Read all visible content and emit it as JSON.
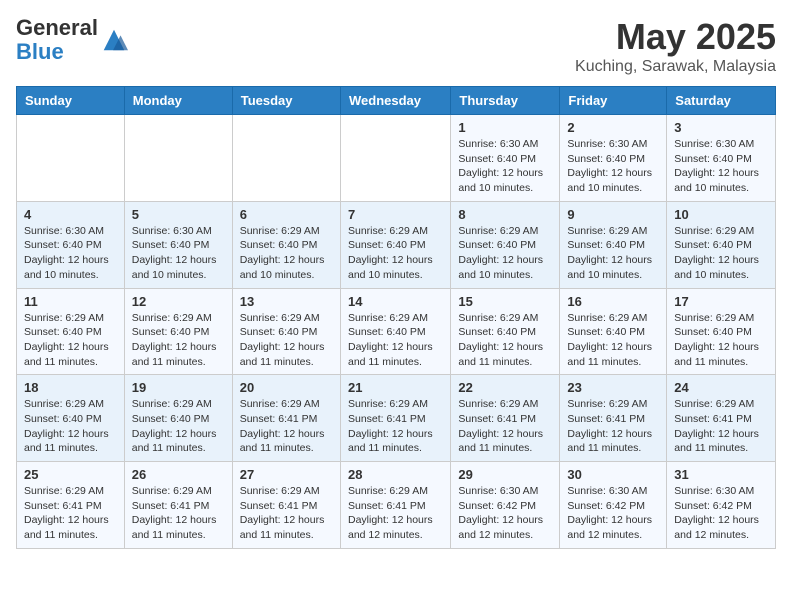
{
  "header": {
    "logo_general": "General",
    "logo_blue": "Blue",
    "month": "May 2025",
    "location": "Kuching, Sarawak, Malaysia"
  },
  "days_of_week": [
    "Sunday",
    "Monday",
    "Tuesday",
    "Wednesday",
    "Thursday",
    "Friday",
    "Saturday"
  ],
  "weeks": [
    [
      {
        "day": "",
        "info": ""
      },
      {
        "day": "",
        "info": ""
      },
      {
        "day": "",
        "info": ""
      },
      {
        "day": "",
        "info": ""
      },
      {
        "day": "1",
        "info": "Sunrise: 6:30 AM\nSunset: 6:40 PM\nDaylight: 12 hours\nand 10 minutes."
      },
      {
        "day": "2",
        "info": "Sunrise: 6:30 AM\nSunset: 6:40 PM\nDaylight: 12 hours\nand 10 minutes."
      },
      {
        "day": "3",
        "info": "Sunrise: 6:30 AM\nSunset: 6:40 PM\nDaylight: 12 hours\nand 10 minutes."
      }
    ],
    [
      {
        "day": "4",
        "info": "Sunrise: 6:30 AM\nSunset: 6:40 PM\nDaylight: 12 hours\nand 10 minutes."
      },
      {
        "day": "5",
        "info": "Sunrise: 6:30 AM\nSunset: 6:40 PM\nDaylight: 12 hours\nand 10 minutes."
      },
      {
        "day": "6",
        "info": "Sunrise: 6:29 AM\nSunset: 6:40 PM\nDaylight: 12 hours\nand 10 minutes."
      },
      {
        "day": "7",
        "info": "Sunrise: 6:29 AM\nSunset: 6:40 PM\nDaylight: 12 hours\nand 10 minutes."
      },
      {
        "day": "8",
        "info": "Sunrise: 6:29 AM\nSunset: 6:40 PM\nDaylight: 12 hours\nand 10 minutes."
      },
      {
        "day": "9",
        "info": "Sunrise: 6:29 AM\nSunset: 6:40 PM\nDaylight: 12 hours\nand 10 minutes."
      },
      {
        "day": "10",
        "info": "Sunrise: 6:29 AM\nSunset: 6:40 PM\nDaylight: 12 hours\nand 10 minutes."
      }
    ],
    [
      {
        "day": "11",
        "info": "Sunrise: 6:29 AM\nSunset: 6:40 PM\nDaylight: 12 hours\nand 11 minutes."
      },
      {
        "day": "12",
        "info": "Sunrise: 6:29 AM\nSunset: 6:40 PM\nDaylight: 12 hours\nand 11 minutes."
      },
      {
        "day": "13",
        "info": "Sunrise: 6:29 AM\nSunset: 6:40 PM\nDaylight: 12 hours\nand 11 minutes."
      },
      {
        "day": "14",
        "info": "Sunrise: 6:29 AM\nSunset: 6:40 PM\nDaylight: 12 hours\nand 11 minutes."
      },
      {
        "day": "15",
        "info": "Sunrise: 6:29 AM\nSunset: 6:40 PM\nDaylight: 12 hours\nand 11 minutes."
      },
      {
        "day": "16",
        "info": "Sunrise: 6:29 AM\nSunset: 6:40 PM\nDaylight: 12 hours\nand 11 minutes."
      },
      {
        "day": "17",
        "info": "Sunrise: 6:29 AM\nSunset: 6:40 PM\nDaylight: 12 hours\nand 11 minutes."
      }
    ],
    [
      {
        "day": "18",
        "info": "Sunrise: 6:29 AM\nSunset: 6:40 PM\nDaylight: 12 hours\nand 11 minutes."
      },
      {
        "day": "19",
        "info": "Sunrise: 6:29 AM\nSunset: 6:40 PM\nDaylight: 12 hours\nand 11 minutes."
      },
      {
        "day": "20",
        "info": "Sunrise: 6:29 AM\nSunset: 6:41 PM\nDaylight: 12 hours\nand 11 minutes."
      },
      {
        "day": "21",
        "info": "Sunrise: 6:29 AM\nSunset: 6:41 PM\nDaylight: 12 hours\nand 11 minutes."
      },
      {
        "day": "22",
        "info": "Sunrise: 6:29 AM\nSunset: 6:41 PM\nDaylight: 12 hours\nand 11 minutes."
      },
      {
        "day": "23",
        "info": "Sunrise: 6:29 AM\nSunset: 6:41 PM\nDaylight: 12 hours\nand 11 minutes."
      },
      {
        "day": "24",
        "info": "Sunrise: 6:29 AM\nSunset: 6:41 PM\nDaylight: 12 hours\nand 11 minutes."
      }
    ],
    [
      {
        "day": "25",
        "info": "Sunrise: 6:29 AM\nSunset: 6:41 PM\nDaylight: 12 hours\nand 11 minutes."
      },
      {
        "day": "26",
        "info": "Sunrise: 6:29 AM\nSunset: 6:41 PM\nDaylight: 12 hours\nand 11 minutes."
      },
      {
        "day": "27",
        "info": "Sunrise: 6:29 AM\nSunset: 6:41 PM\nDaylight: 12 hours\nand 11 minutes."
      },
      {
        "day": "28",
        "info": "Sunrise: 6:29 AM\nSunset: 6:41 PM\nDaylight: 12 hours\nand 12 minutes."
      },
      {
        "day": "29",
        "info": "Sunrise: 6:30 AM\nSunset: 6:42 PM\nDaylight: 12 hours\nand 12 minutes."
      },
      {
        "day": "30",
        "info": "Sunrise: 6:30 AM\nSunset: 6:42 PM\nDaylight: 12 hours\nand 12 minutes."
      },
      {
        "day": "31",
        "info": "Sunrise: 6:30 AM\nSunset: 6:42 PM\nDaylight: 12 hours\nand 12 minutes."
      }
    ]
  ]
}
